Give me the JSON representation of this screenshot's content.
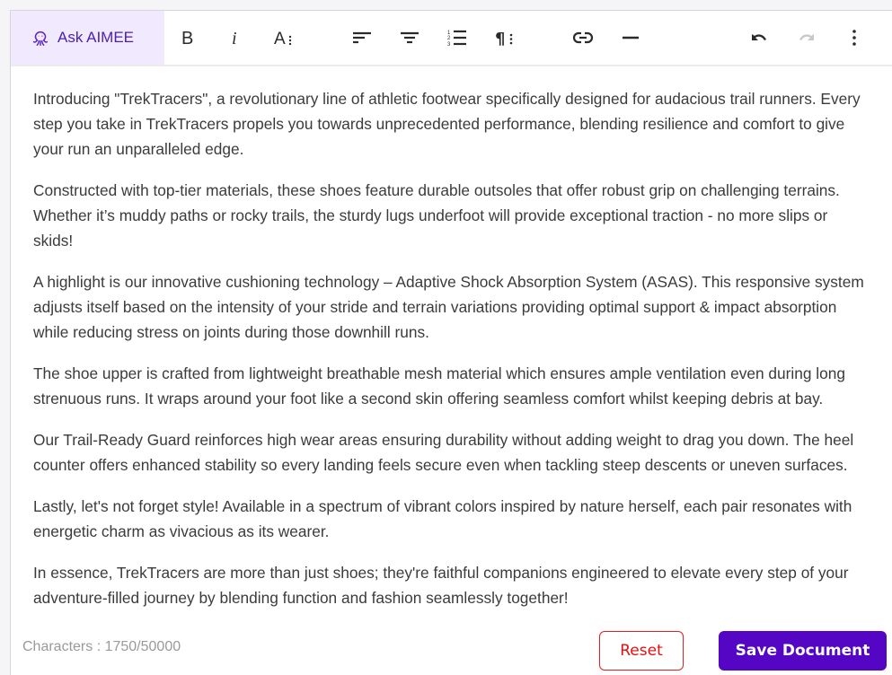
{
  "toolbar": {
    "ask_aimee_label": "Ask AIMEE",
    "buttons": [
      {
        "name": "bold",
        "icon": "bold-icon"
      },
      {
        "name": "italic",
        "icon": "italic-icon"
      },
      {
        "name": "font-size",
        "icon": "font-size-icon"
      },
      {
        "name": "align-left",
        "icon": "align-left-icon"
      },
      {
        "name": "align-center",
        "icon": "align-center-icon"
      },
      {
        "name": "numbered-list",
        "icon": "numbered-list-icon"
      },
      {
        "name": "paragraph-format",
        "icon": "paragraph-icon"
      },
      {
        "name": "insert-link",
        "icon": "link-icon"
      },
      {
        "name": "horizontal-line",
        "icon": "horizontal-line-icon"
      },
      {
        "name": "undo",
        "icon": "undo-icon"
      },
      {
        "name": "redo",
        "icon": "redo-icon",
        "disabled": true
      },
      {
        "name": "more-options",
        "icon": "more-vertical-icon"
      }
    ]
  },
  "document": {
    "paragraphs": [
      "Introducing \"TrekTracers\", a revolutionary line of athletic footwear specifically designed for audacious trail runners. Every step you take in TrekTracers propels you towards unprecedented performance, blending resilience and comfort to give your run an unparalleled edge.",
      "Constructed with top-tier materials, these shoes feature durable outsoles that offer robust grip on challenging terrains. Whether it’s muddy paths or rocky trails, the sturdy lugs underfoot will provide exceptional traction - no more slips or skids!",
      "A highlight is our innovative cushioning technology – Adaptive Shock Absorption System (ASAS). This responsive system adjusts itself based on the intensity of your stride and terrain variations providing optimal support & impact absorption while reducing stress on joints during those downhill runs.",
      "The shoe upper is crafted from lightweight breathable mesh material which ensures ample ventilation even during long strenuous runs. It wraps around your foot like a second skin offering seamless comfort whilst keeping debris at bay.",
      "Our Trail-Ready Guard reinforces high wear areas ensuring durability without adding weight to drag you down. The heel counter offers enhanced stability so every landing feels secure even when tackling steep descents or uneven surfaces.",
      "Lastly, let's not forget style! Available in a spectrum of vibrant colors inspired by nature herself, each pair resonates with energetic charm as vivacious as its wearer.",
      "In essence, TrekTracers are more than just shoes; they're faithful companions engineered to elevate every step of your adventure-filled journey by blending function and fashion seamlessly together!"
    ]
  },
  "footer": {
    "char_count": "Characters : 1750/50000",
    "reset_label": "Reset",
    "save_label": "Save Document"
  },
  "colors": {
    "accent": "#5406c4",
    "aimee_bg": "#f1e9fd",
    "reset": "#e01010"
  }
}
